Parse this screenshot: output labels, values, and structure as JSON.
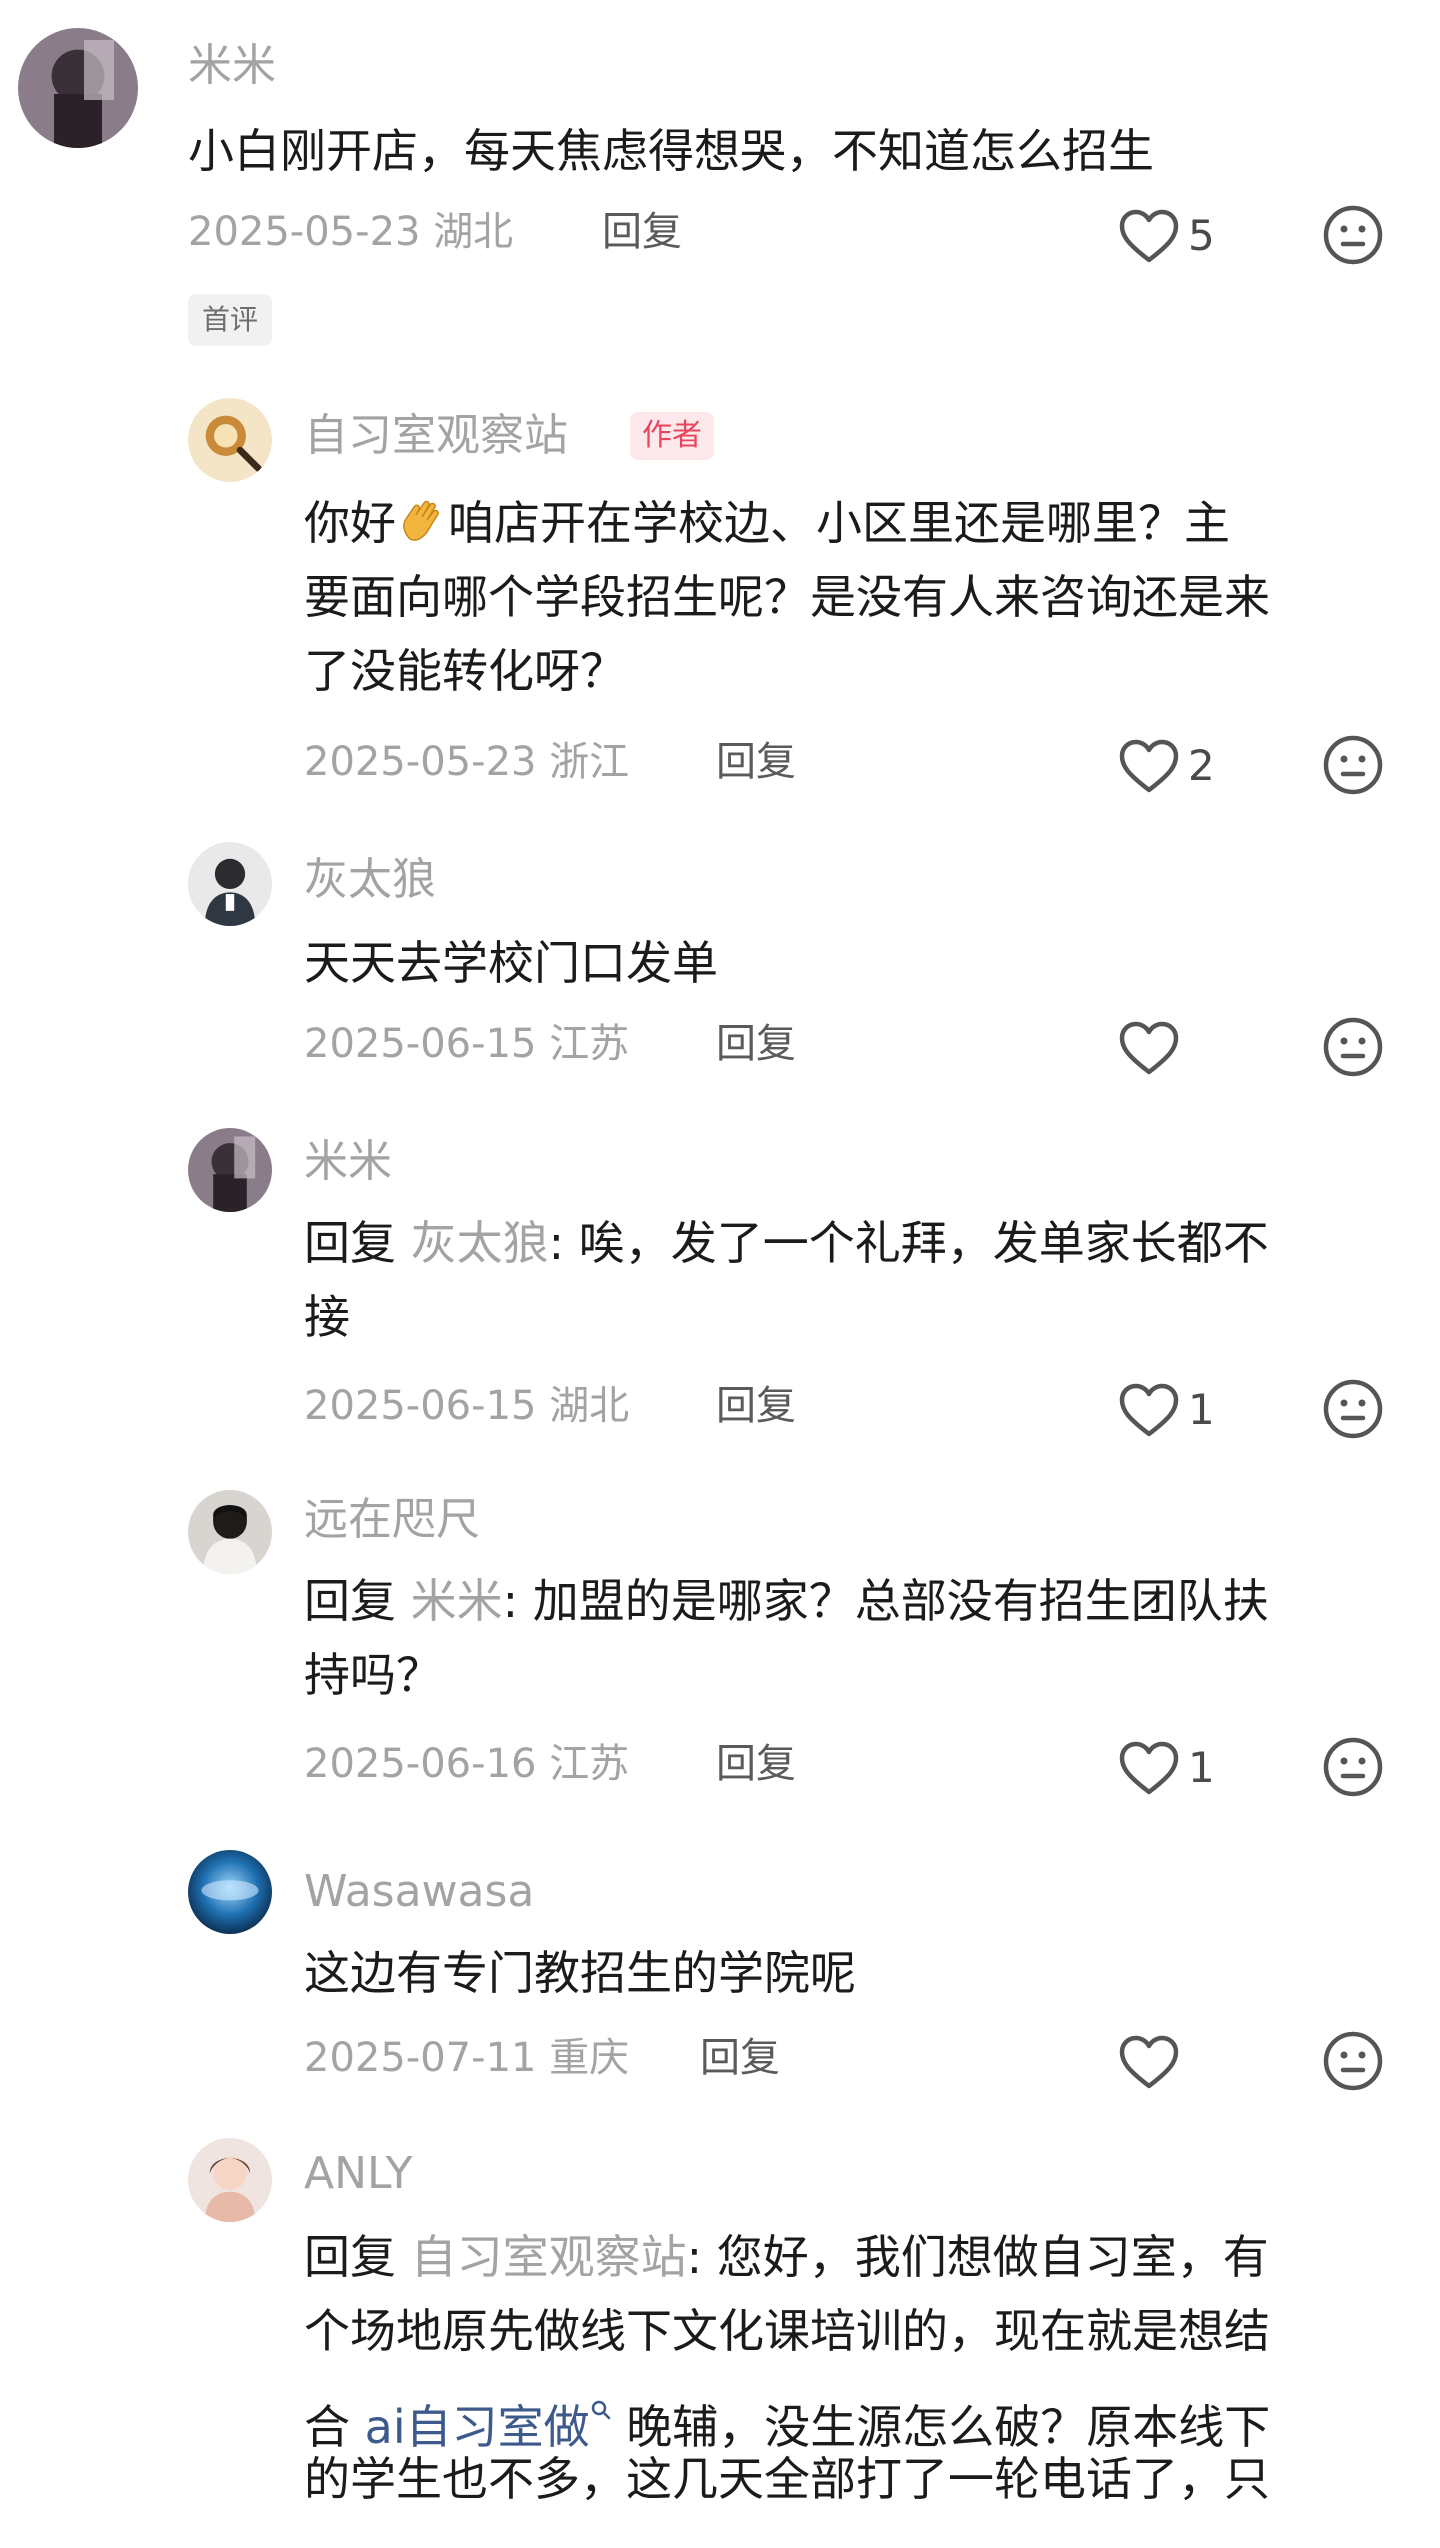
{
  "comments": [
    {
      "username": "米米",
      "lines": [
        "小白刚开店，每天焦虑得想哭，不知道怎么招生"
      ],
      "date": "2025-05-23",
      "region": "湖北",
      "reply_label": "回复",
      "likes": "5",
      "tag": "首评"
    },
    {
      "username": "自习室观察站",
      "badge": "作者",
      "line1_prefix": "你好",
      "line1_suffix": "咱店开在学校边、小区里还是哪里？主",
      "lines_rest": [
        "要面向哪个学段招生呢？是没有人来咨询还是来",
        "了没能转化呀？"
      ],
      "date": "2025-05-23",
      "region": "浙江",
      "reply_label": "回复",
      "likes": "2"
    },
    {
      "username": "灰太狼",
      "lines": [
        "天天去学校门口发单"
      ],
      "date": "2025-06-15",
      "region": "江苏",
      "reply_label": "回复",
      "likes": ""
    },
    {
      "username": "米米",
      "reply_prefix": "回复",
      "reply_target": "灰太狼",
      "line1": ": 唉，发了一个礼拜，发单家长都不",
      "lines_rest": [
        "接"
      ],
      "date": "2025-06-15",
      "region": "湖北",
      "reply_label": "回复",
      "likes": "1"
    },
    {
      "username": "远在咫尺",
      "reply_prefix": "回复",
      "reply_target": "米米",
      "line1": ": 加盟的是哪家？总部没有招生团队扶",
      "lines_rest": [
        "持吗？"
      ],
      "date": "2025-06-16",
      "region": "江苏",
      "reply_label": "回复",
      "likes": "1"
    },
    {
      "username": "Wasawasa",
      "lines": [
        "这边有专门教招生的学院呢"
      ],
      "date": "2025-07-11",
      "region": "重庆",
      "reply_label": "回复",
      "likes": ""
    },
    {
      "username": "ANLY",
      "reply_prefix": "回复",
      "reply_target": "自习室观察站",
      "line1": ": 您好，我们想做自习室，有",
      "line2": "个场地原先做线下文化课培训的，现在就是想结",
      "line3_prefix": "合 ",
      "line3_link": "ai自习室做",
      "line3_suffix": " 晚辅，没生源怎么破？原本线下",
      "line4": "的学生也不多，这几天全部打了一轮电话了，只"
    }
  ],
  "icons": {
    "like": "heart-outline-icon",
    "emoji": "neutral-face-icon",
    "search_hint": "search-superscript-icon",
    "wave": "waving-hand-emoji"
  },
  "colors": {
    "username": "#a3a3a3",
    "text": "#1b1b1b",
    "badge_text": "#e8455e",
    "badge_bg": "#fde9ec",
    "link": "#3c5a8c"
  }
}
